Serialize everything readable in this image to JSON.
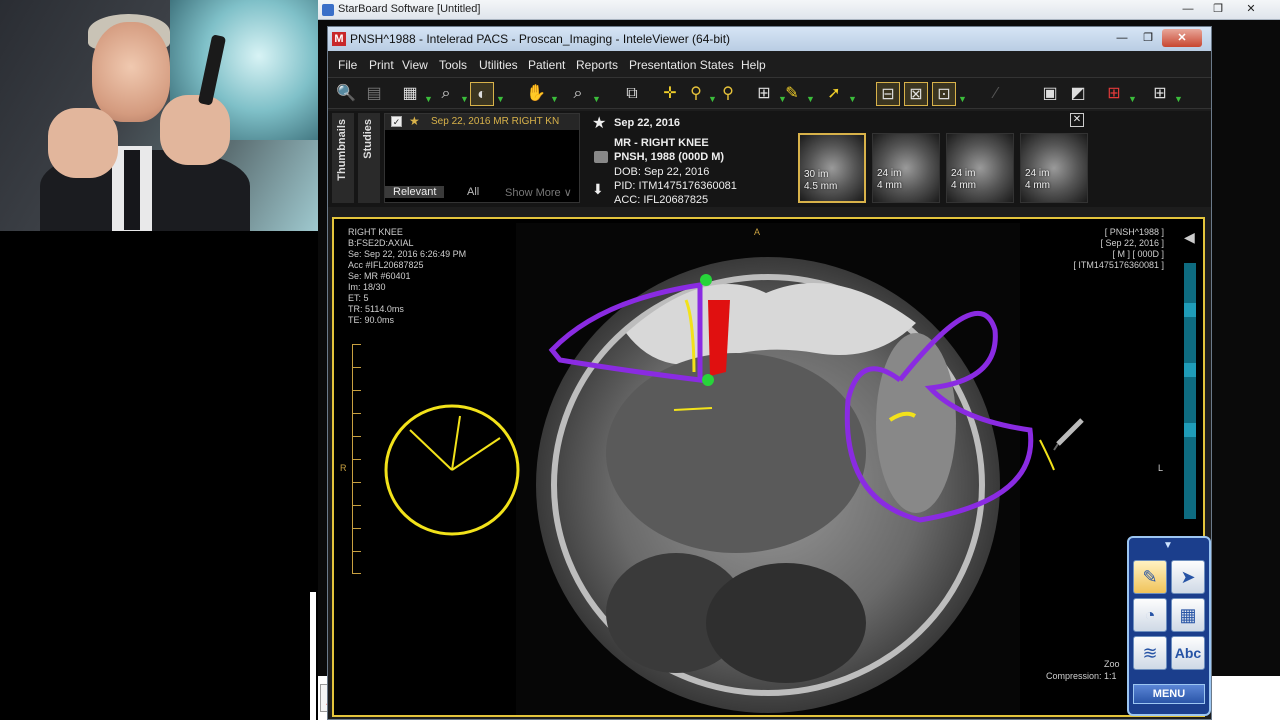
{
  "starboard": {
    "window_title": "StarBoard Software [Untitled]",
    "palette_menu_label": "MENU"
  },
  "pacs_window": {
    "title": "PNSH^1988 - Intelerad PACS - Proscan_Imaging - InteleViewer (64-bit)"
  },
  "menu": [
    "File",
    "Print",
    "View",
    "Tools",
    "Utilities",
    "Patient",
    "Reports",
    "Presentation States",
    "Help"
  ],
  "study_panel": {
    "tab_thumbnails": "Thumbnails",
    "tab_studies": "Studies",
    "study_row": "Sep 22, 2016  MR  RIGHT KN",
    "relevant_tab": "Relevant",
    "all_tab": "All",
    "show_more": "Show More ∨",
    "date": "Sep 22, 2016",
    "desc": "MR - RIGHT KNEE",
    "patient": "PNSH, 1988 (000D M)",
    "dob": "DOB: Sep 22, 2016",
    "pid": "PID: ITM1475176360081",
    "acc": "ACC: IFL20687825"
  },
  "thumbnails": [
    {
      "images": "30 im",
      "thickness": "4.5 mm"
    },
    {
      "images": "24 im",
      "thickness": "4 mm"
    },
    {
      "images": "24 im",
      "thickness": "4 mm"
    },
    {
      "images": "24 im",
      "thickness": "4 mm"
    }
  ],
  "viewer": {
    "left_overlay": [
      "RIGHT KNEE",
      "B:FSE2D:AXIAL",
      "Se: Sep 22, 2016 6:26:49 PM",
      "Acc #IFL20687825",
      "Se: MR #60401",
      "Im: 18/30",
      "ET: 5",
      "TR: 5114.0ms",
      "TE: 90.0ms"
    ],
    "right_overlay": [
      "[ PNSH^1988 ]",
      "[ Sep 22, 2016 ]",
      "[ M ] [ 000D ]",
      "[ ITM1475176360081 ]"
    ],
    "orientation_top": "A",
    "orientation_left": "R",
    "orientation_right": "L",
    "zoom_label": "Zoo",
    "compression_label": "Compression: 1:1"
  },
  "colors": {
    "accent_yellow": "#e3c43c",
    "annotation_purple": "#8a2be2",
    "annotation_yellow": "#f2e21a",
    "annotation_red": "#e01010",
    "annotation_green": "#27d43a"
  }
}
